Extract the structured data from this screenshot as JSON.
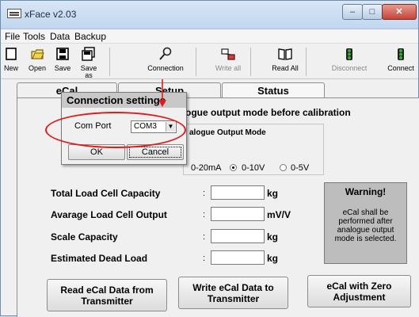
{
  "window": {
    "title": "xFace  v2.03",
    "controls": {
      "minimize": "–",
      "maximize": "□",
      "close": "✕"
    }
  },
  "menu": [
    "File",
    "Tools",
    "Data",
    "Backup"
  ],
  "toolbar": [
    {
      "label": "New",
      "icon": "new-icon",
      "enabled": true
    },
    {
      "label": "Open",
      "icon": "open-folder-icon",
      "enabled": true
    },
    {
      "label": "Save",
      "icon": "save-icon",
      "enabled": true
    },
    {
      "label": "Save\nas",
      "icon": "save-as-icon",
      "enabled": true
    },
    {
      "label": "Connection",
      "icon": "connection-icon",
      "enabled": true
    },
    {
      "label": "Write all",
      "icon": "write-all-icon",
      "enabled": false
    },
    {
      "label": "Read All",
      "icon": "read-all-icon",
      "enabled": true
    },
    {
      "label": "Disconnect",
      "icon": "traffic-light-icon",
      "enabled": false
    },
    {
      "label": "Connect",
      "icon": "traffic-light-icon",
      "enabled": true
    }
  ],
  "tabs": [
    "eCal",
    "Setup",
    "Status"
  ],
  "main": {
    "calibration_note": "ogue output mode before calibration",
    "group_title": "alogue Output Mode",
    "modes": [
      "0-20mA",
      "0-10V",
      "0-5V"
    ],
    "selected_mode": "0-10V",
    "fields": [
      {
        "label": "Total Load Cell Capacity",
        "colon": ":",
        "value": "",
        "unit": "kg"
      },
      {
        "label": "Avarage Load Cell Output",
        "colon": ":",
        "value": "",
        "unit": "mV/V"
      },
      {
        "label": "Scale Capacity",
        "colon": ":",
        "value": "",
        "unit": "kg"
      },
      {
        "label": "Estimated Dead Load",
        "colon": ":",
        "value": "",
        "unit": "kg"
      }
    ],
    "warning": {
      "title": "Warning!",
      "text": "eCal shall be performed after analogue output mode is selected."
    },
    "buttons": [
      "Read eCal Data from Transmitter",
      "Write eCal Data to Transmitter",
      "eCal with Zero Adjustment"
    ]
  },
  "dialog": {
    "title": "Connection settings",
    "port_label": "Com Port",
    "port_value": "COM3",
    "ok": "OK",
    "cancel": "Cancel"
  },
  "colors": {
    "annotation": "#e01b1b",
    "window_frame": "#6e8db3",
    "warning_bg": "#bdbdbd"
  }
}
